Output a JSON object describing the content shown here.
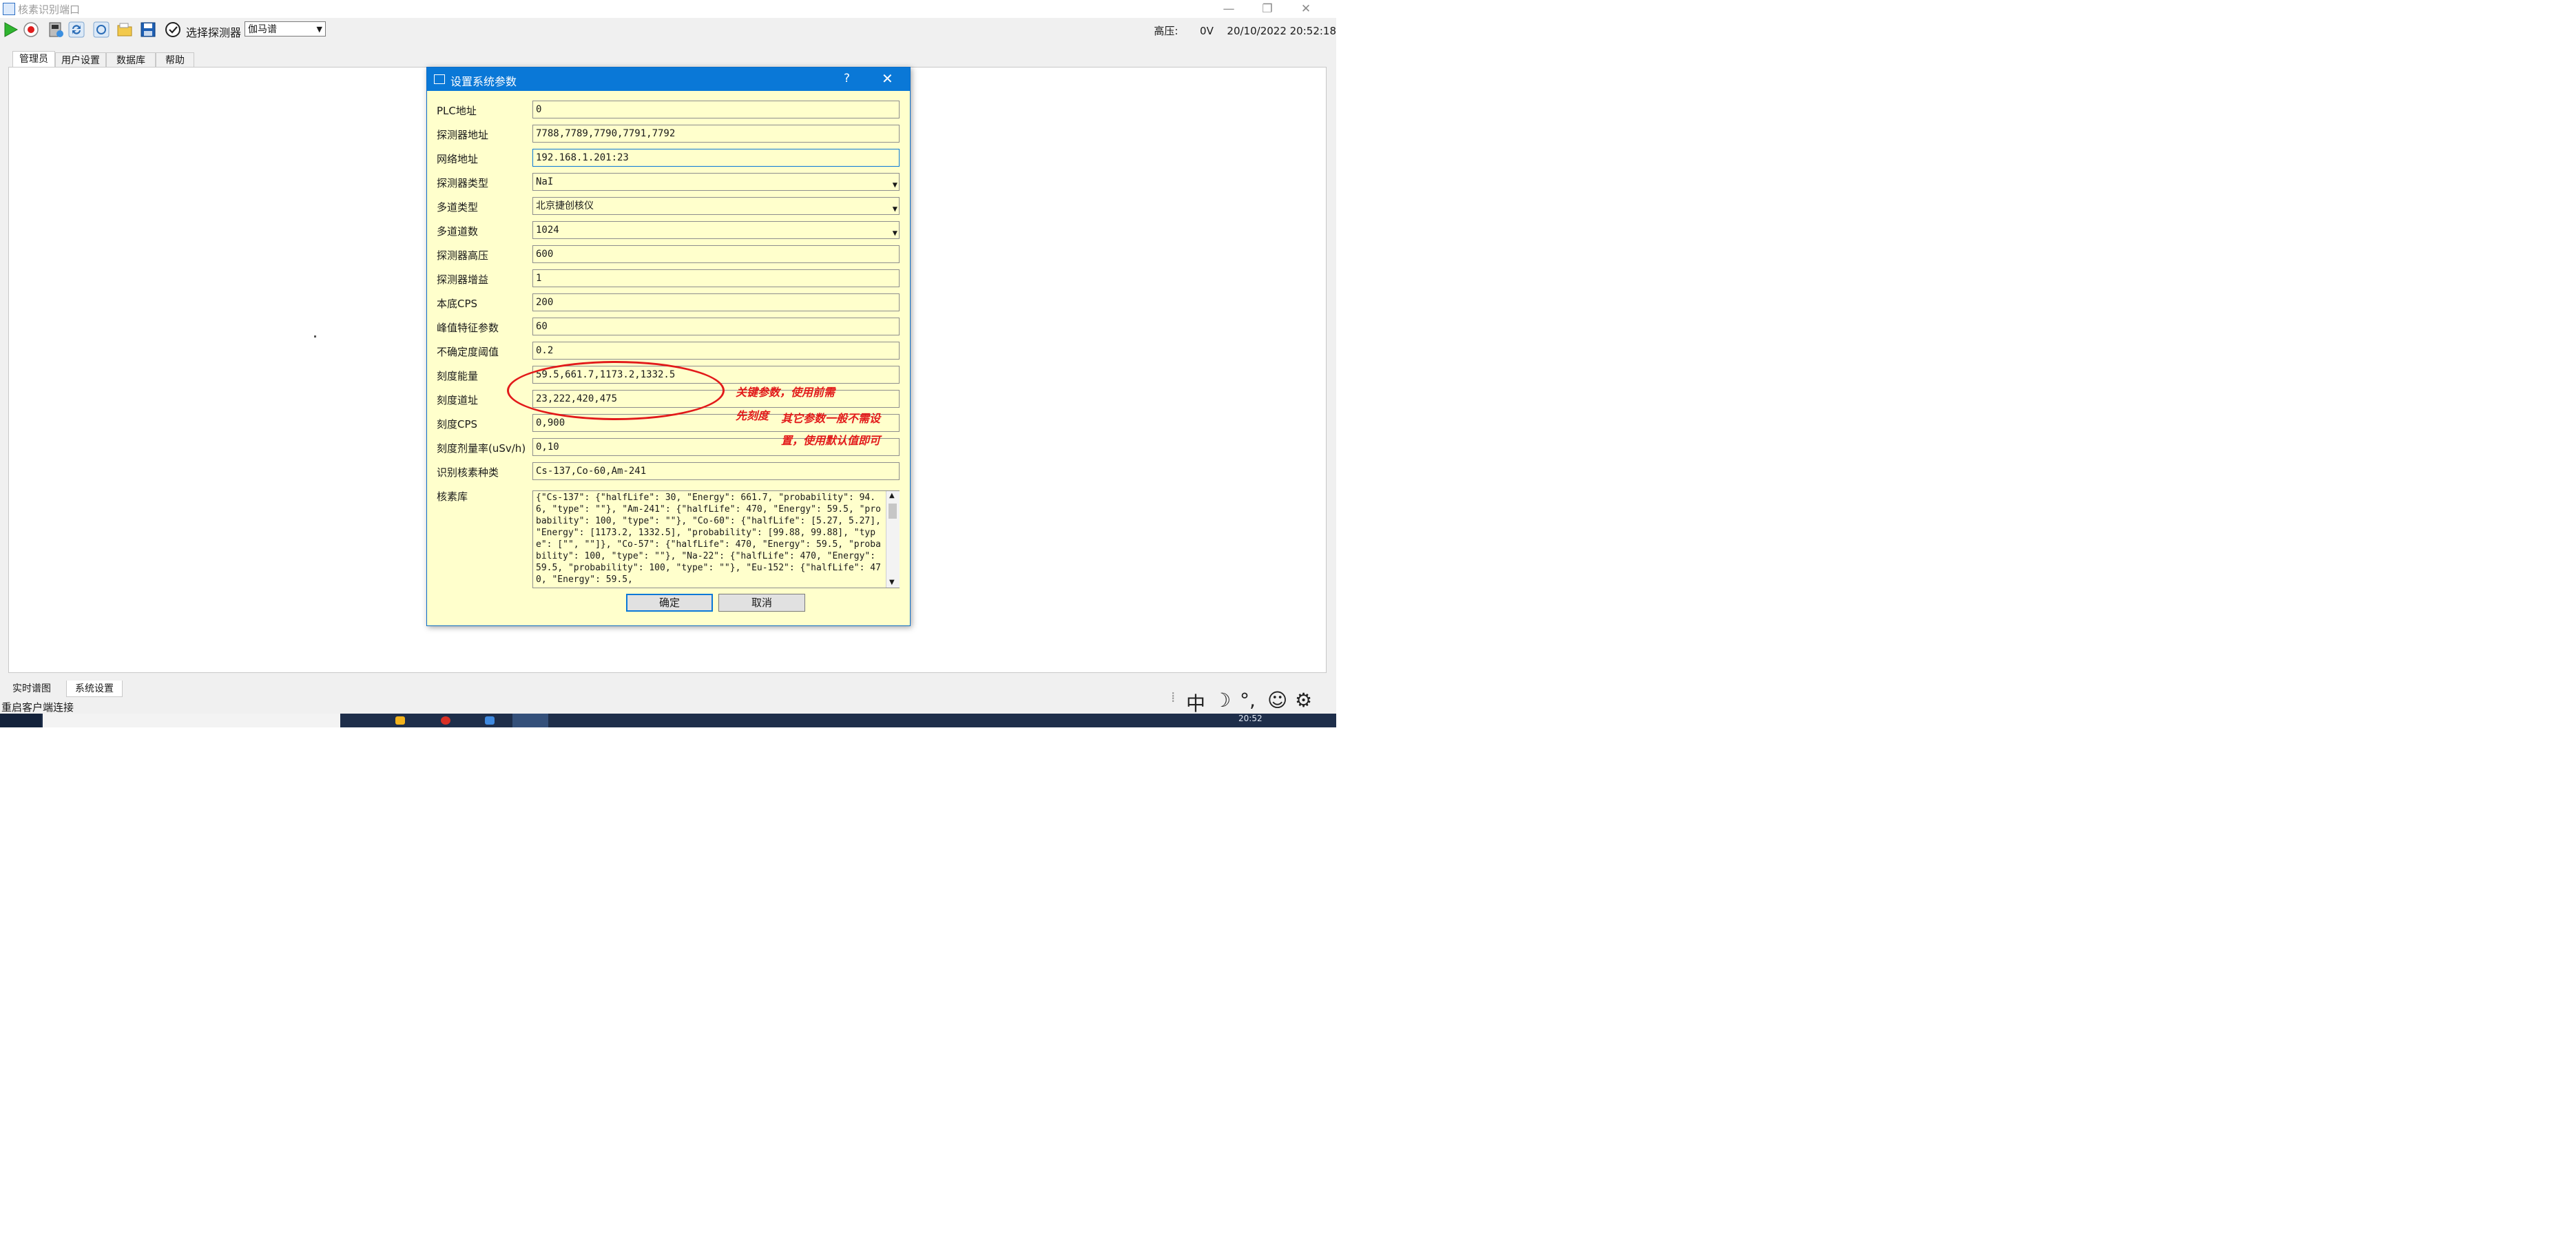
{
  "window": {
    "title": "核素识别端口"
  },
  "toolbar": {
    "detector_label": "选择探测器",
    "detector_value": "伽马谱",
    "high_voltage_label": "高压:",
    "high_voltage_value": "0V",
    "datetime": "20/10/2022 20:52:18"
  },
  "top_tabs": [
    "管理员",
    "用户设置",
    "数据库",
    "帮助"
  ],
  "bottom_tabs": [
    "实时谱图",
    "系统设置"
  ],
  "status_text": "重启客户端连接",
  "dialog": {
    "title": "设置系统参数",
    "help": "?",
    "fields": [
      {
        "label": "PLC地址",
        "value": "0"
      },
      {
        "label": "探测器地址",
        "value": "7788,7789,7790,7791,7792"
      },
      {
        "label": "网络地址",
        "value": "192.168.1.201:23"
      },
      {
        "label": "探测器类型",
        "value": "NaI"
      },
      {
        "label": "多道类型",
        "value": "北京捷创核仪"
      },
      {
        "label": "多道道数",
        "value": "1024"
      },
      {
        "label": "探测器高压",
        "value": "600"
      },
      {
        "label": "探测器增益",
        "value": "1"
      },
      {
        "label": "本底CPS",
        "value": "200"
      },
      {
        "label": "峰值特征参数",
        "value": "60"
      },
      {
        "label": "不确定度阈值",
        "value": "0.2"
      },
      {
        "label": "刻度能量",
        "value": "59.5,661.7,1173.2,1332.5"
      },
      {
        "label": "刻度道址",
        "value": "23,222,420,475"
      },
      {
        "label": "刻度CPS",
        "value": "0,900"
      },
      {
        "label": "刻度剂量率(uSv/h)",
        "value": "0,10"
      },
      {
        "label": "识别核素种类",
        "value": "Cs-137,Co-60,Am-241"
      }
    ],
    "nuclide_label": "核素库",
    "nuclide_text": "{\"Cs-137\": {\"halfLife\": 30, \"Energy\": 661.7, \"probability\": 94.6, \"type\": \"\"}, \"Am-241\": {\"halfLife\": 470, \"Energy\": 59.5, \"probability\": 100, \"type\": \"\"}, \"Co-60\": {\"halfLife\": [5.27, 5.27], \"Energy\": [1173.2, 1332.5], \"probability\": [99.88, 99.88], \"type\": [\"\", \"\"]}, \"Co-57\": {\"halfLife\": 470, \"Energy\": 59.5, \"probability\": 100, \"type\": \"\"}, \"Na-22\": {\"halfLife\": 470, \"Energy\": 59.5, \"probability\": 100, \"type\": \"\"}, \"Eu-152\": {\"halfLife\": 470, \"Energy\": 59.5,",
    "ok_label": "确定",
    "cancel_label": "取消"
  },
  "annotations": {
    "line1": "关键参数，使用前需",
    "line2": "先刻度",
    "line3": "其它参数一般不需设",
    "line4": "置，使用默认值即可",
    "color": "#e21a1a"
  },
  "taskbar": {
    "clock": "20:52"
  },
  "ime": [
    "中",
    "☽",
    "°,",
    "☺",
    "⚙"
  ],
  "colors": {
    "dialog_bg": "#ffffcc",
    "title_blue": "#0a78d7"
  }
}
